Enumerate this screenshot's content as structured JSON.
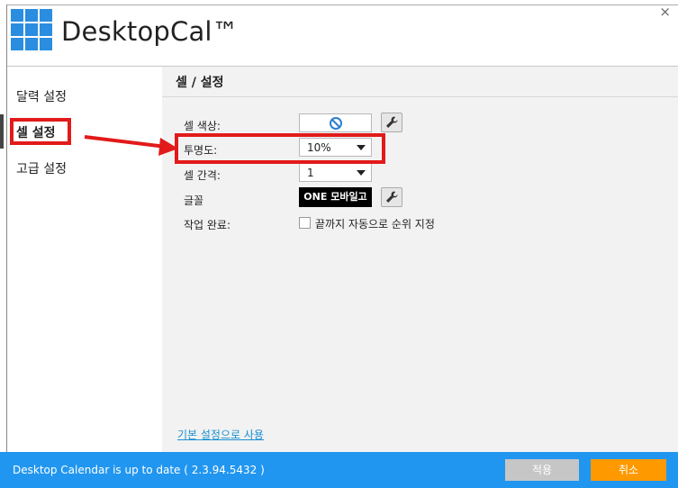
{
  "window": {
    "app_title": "DesktopCal™",
    "close_glyph": "×"
  },
  "sidebar": {
    "items": [
      {
        "label": "달력 설정",
        "selected": false
      },
      {
        "label": "셀 설정",
        "selected": true
      },
      {
        "label": "고급 설정",
        "selected": false
      }
    ]
  },
  "content": {
    "section_title": "셀 / 설정",
    "cell_color": {
      "label": "셀 색상:",
      "icon": "no-color-icon"
    },
    "opacity": {
      "label": "투명도:",
      "value": "10%"
    },
    "cell_spacing": {
      "label": "셀 간격:",
      "value": "1"
    },
    "font": {
      "label": "글꼴",
      "value": "ONE 모바일고"
    },
    "task_done": {
      "label": "작업 완료:",
      "checkbox_label": "끝까지 자동으로 순위 지정",
      "checked": false
    },
    "default_link": "기본 설정으로 사용"
  },
  "statusbar": {
    "text": "Desktop Calendar is up to date ( 2.3.94.5432 )",
    "apply_label": "적용",
    "cancel_label": "취소"
  },
  "colors": {
    "accent_blue": "#2196f0",
    "logo_blue": "#2a8de0",
    "cancel_orange": "#ff9900",
    "apply_gray": "#c6c6c6",
    "annotation_red": "#e21a1a",
    "link_blue": "#1a8fd0"
  }
}
